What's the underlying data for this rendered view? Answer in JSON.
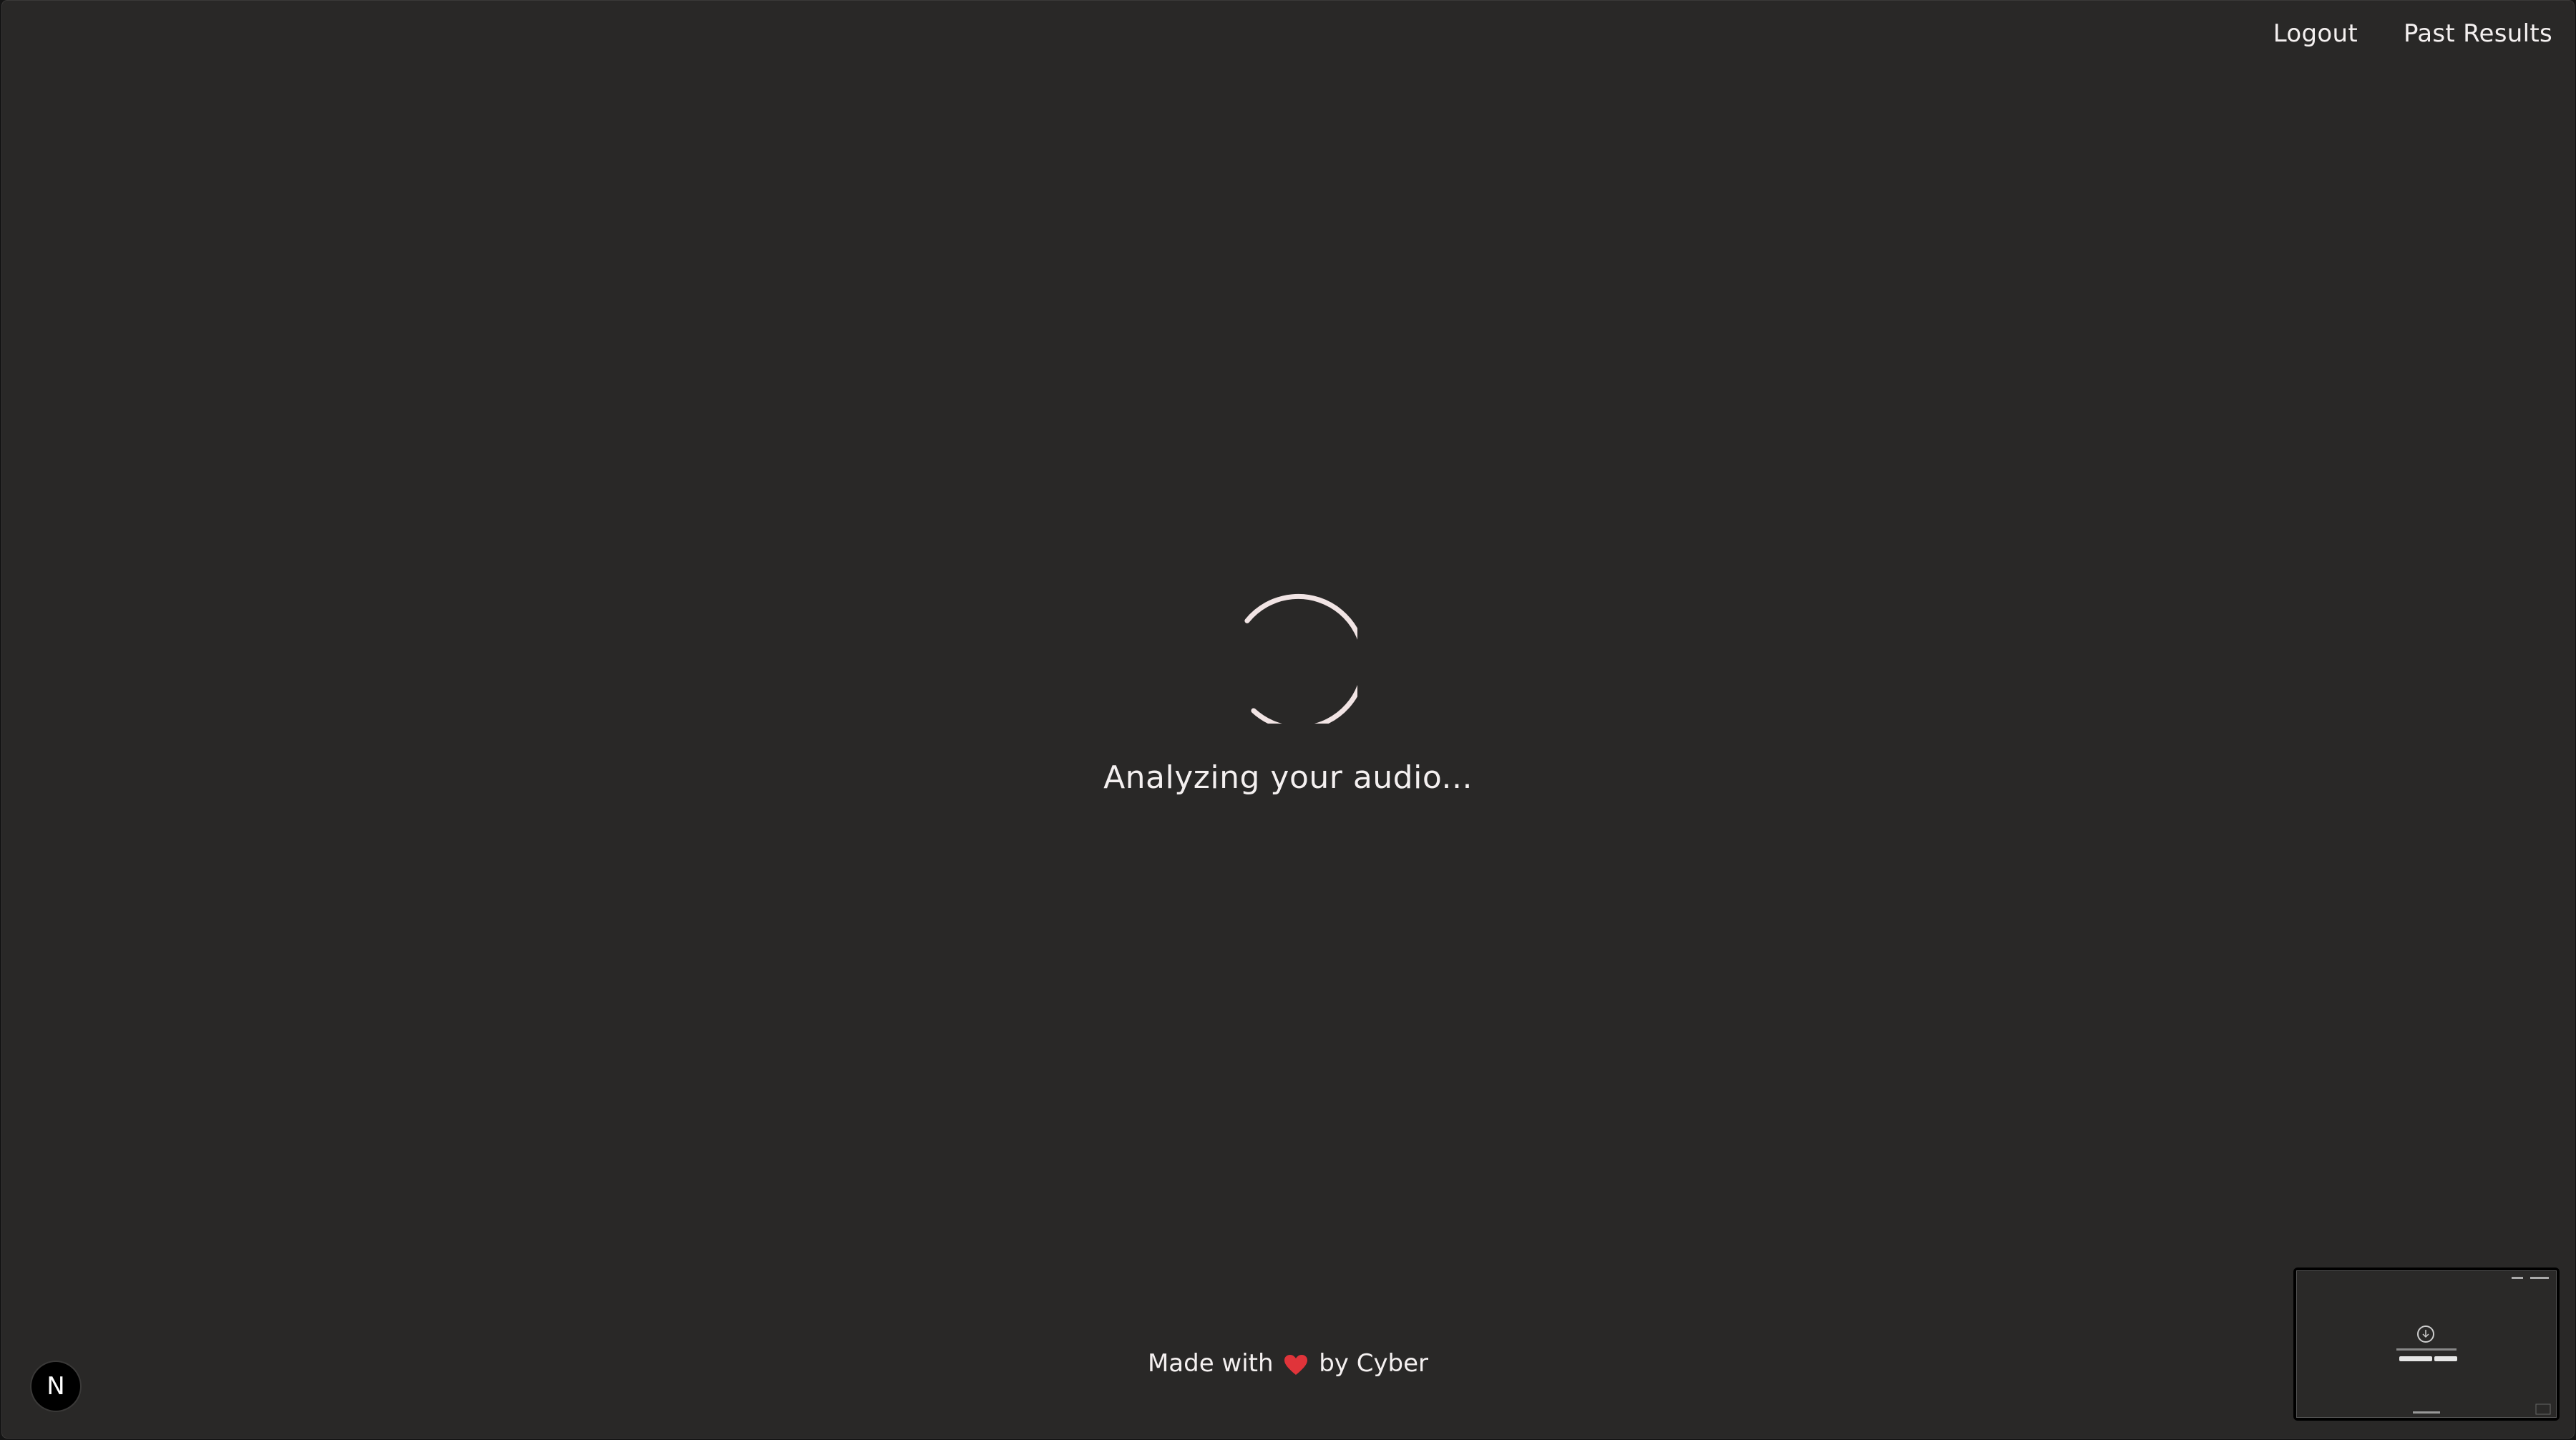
{
  "nav": {
    "logout_label": "Logout",
    "past_results_label": "Past Results"
  },
  "status": {
    "message": "Analyzing your audio..."
  },
  "footer": {
    "prefix": "Made with",
    "heart_icon": "heart-icon",
    "suffix": "by Cyber"
  },
  "badge": {
    "letter": "N"
  },
  "colors": {
    "background": "#292827",
    "text": "#f4f0f0",
    "spinner": "#f1e4e4",
    "heart": "#e0343a"
  }
}
